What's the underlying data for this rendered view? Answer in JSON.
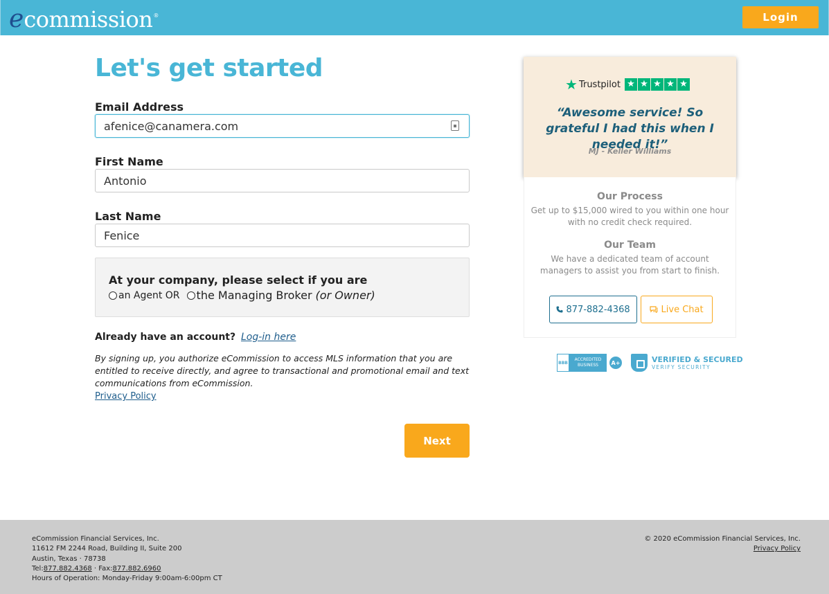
{
  "header": {
    "logo_first": "e",
    "logo_rest": "commission",
    "logo_mark": "®",
    "login_label": "Login"
  },
  "form": {
    "title": "Let's get started",
    "email": {
      "label": "Email Address",
      "value": "afenice@canamera.com"
    },
    "first_name": {
      "label": "First Name",
      "value": "Antonio"
    },
    "last_name": {
      "label": "Last Name",
      "value": "Fenice"
    },
    "role": {
      "title": "At your company, please select if you are",
      "option_agent": "an Agent OR",
      "option_broker": "the Managing Broker",
      "option_broker_note": "(or Owner)"
    },
    "already_text": "Already have an account?",
    "login_link": "Log-in here",
    "disclaimer": "By signing up, you authorize eCommission to access MLS information that you are entitled to receive directly, and agree to transactional and promotional email and text communications from eCommission.",
    "privacy_link": "Privacy Policy",
    "next_label": "Next"
  },
  "review": {
    "brand_star": "★",
    "brand": "Trustpilot",
    "rating_stars": [
      "★",
      "★",
      "★",
      "★",
      "★"
    ],
    "quote": "“Awesome service! So grateful I had this when I needed it!”",
    "author": "MJ - Keller Williams"
  },
  "info": {
    "process_title": "Our Process",
    "process_text": "Get up to $15,000 wired to you within one hour with no credit check required.",
    "team_title": "Our Team",
    "team_text": "We have a dedicated team of account managers to assist you from start to finish.",
    "phone_icon": "phone-icon",
    "phone_label": "877-882-4368",
    "chat_icon": "chat-icon",
    "chat_label": "Live Chat"
  },
  "badges": {
    "bbb_logo": "BBB",
    "bbb_text": "ACCREDITED BUSINESS",
    "bbb_grade": "A+",
    "secured_title": "VERIFIED & SECURED",
    "secured_sub": "VERIFY SECURITY"
  },
  "footer": {
    "company": "eCommission Financial Services, Inc.",
    "address1": "11612 FM 2244 Road, Building II, Suite 200",
    "address2": "Austin, Texas · 78738",
    "tel_label": "Tel:",
    "tel": "877.882.4368",
    "fax_label": " · Fax:",
    "fax": "877.882.6960",
    "hours": "Hours of Operation: Monday-Friday 9:00am-6:00pm CT",
    "copyright": "© 2020 eCommission Financial Services, Inc.",
    "privacy_link": "Privacy Policy"
  },
  "colors": {
    "brand_blue": "#49b6d6",
    "accent_orange": "#f9a81c",
    "trustpilot_green": "#00b67a",
    "quote_teal": "#1d5f7a"
  }
}
